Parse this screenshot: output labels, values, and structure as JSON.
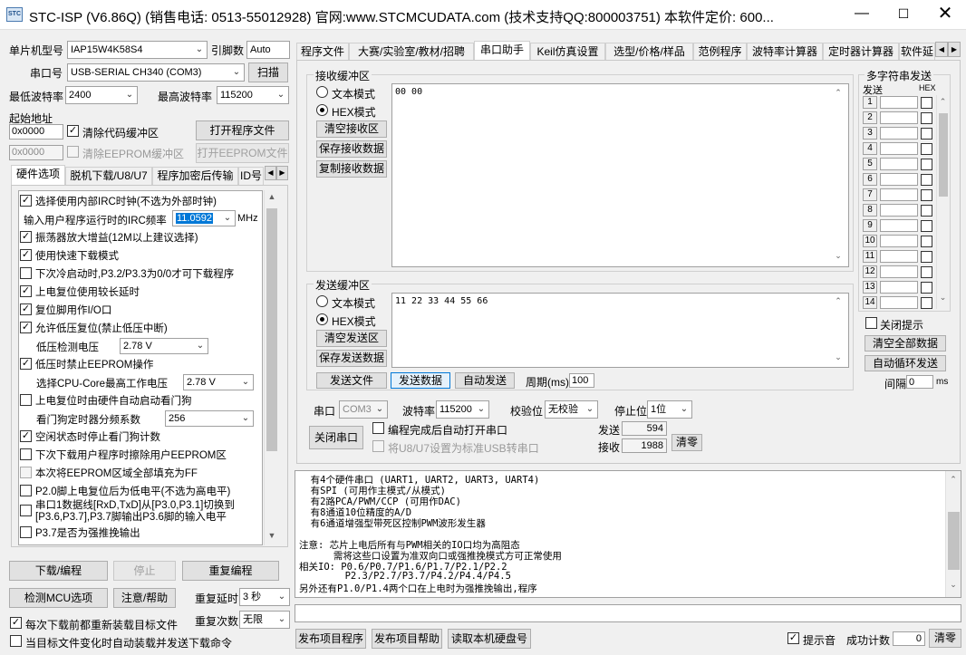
{
  "window": {
    "title": "STC-ISP (V6.86Q) (销售电话: 0513-55012928) 官网:www.STCMCUDATA.com  (技术支持QQ:800003751) 本软件定价: 600...",
    "icon_text": "STC"
  },
  "left": {
    "mcu_label": "单片机型号",
    "mcu_value": "IAP15W4K58S4",
    "pin_label": "引脚数",
    "pin_value": "Auto",
    "port_label": "串口号",
    "port_value": "USB-SERIAL CH340 (COM3)",
    "scan_btn": "扫描",
    "minbaud_label": "最低波特率",
    "minbaud_value": "2400",
    "maxbaud_label": "最高波特率",
    "maxbaud_value": "115200",
    "start_addr_label": "起始地址",
    "addr1": "0x0000",
    "clear_code_label": "清除代码缓冲区",
    "open_prog_btn": "打开程序文件",
    "addr2": "0x0000",
    "clear_eeprom_label": "清除EEPROM缓冲区",
    "open_eeprom_btn": "打开EEPROM文件",
    "tabs": [
      "硬件选项",
      "脱机下载/U8/U7",
      "程序加密后传输",
      "ID号"
    ],
    "options": {
      "irc_label": "选择使用内部IRC时钟(不选为外部时钟)",
      "freq_label": "输入用户程序运行时的IRC频率",
      "freq_value": "11.0592",
      "freq_unit": "MHz",
      "osc_gain": "振荡器放大增益(12M以上建议选择)",
      "fast_dl": "使用快速下载模式",
      "cold_boot": "下次冷启动时,P3.2/P3.3为0/0才可下载程序",
      "reset_delay": "上电复位使用较长延时",
      "reset_pin": "复位脚用作I/O口",
      "low_volt_reset": "允许低压复位(禁止低压中断)",
      "low_volt_label": "低压检测电压",
      "low_volt_value": "2.78 V",
      "low_volt_eeprom": "低压时禁止EEPROM操作",
      "cpu_volt_label": "选择CPU-Core最高工作电压",
      "cpu_volt_value": "2.78 V",
      "wdt_poweron": "上电复位时由硬件自动启动看门狗",
      "wdt_div_label": "看门狗定时器分频系数",
      "wdt_div_value": "256",
      "idle_wdt": "空闲状态时停止看门狗计数",
      "erase_eeprom": "下次下载用户程序时擦除用户EEPROM区",
      "fill_ff": "本次将EEPROM区域全部填充为FF",
      "p20_low": "P2.0脚上电复位后为低电平(不选为高电平)",
      "uart_switch_1": "串口1数据线[RxD,TxD]从[P3.0,P3.1]切换到",
      "uart_switch_2": "[P3.6,P3.7],P3.7脚输出P3.6脚的输入电平",
      "p37_pushpull": "P3.7是否为强推挽输出"
    },
    "download_btn": "下载/编程",
    "stop_btn": "停止",
    "reprogram_btn": "重复编程",
    "detect_btn": "检测MCU选项",
    "help_btn": "注意/帮助",
    "repeat_delay_label": "重复延时",
    "repeat_delay_value": "3 秒",
    "reload_label": "每次下载前都重新装载目标文件",
    "repeat_count_label": "重复次数",
    "repeat_count_value": "无限",
    "auto_send_label": "当目标文件变化时自动装载并发送下载命令"
  },
  "right": {
    "tabs": [
      "程序文件",
      "大赛/实验室/教材/招聘",
      "串口助手",
      "Keil仿真设置",
      "选型/价格/样品",
      "范例程序",
      "波特率计算器",
      "定时器计算器",
      "软件延"
    ],
    "recv": {
      "group": "接收缓冲区",
      "text_mode": "文本模式",
      "hex_mode": "HEX模式",
      "clear_btn": "清空接收区",
      "save_btn": "保存接收数据",
      "copy_btn": "复制接收数据",
      "content": "00 00"
    },
    "send": {
      "group": "发送缓冲区",
      "text_mode": "文本模式",
      "hex_mode": "HEX模式",
      "clear_btn": "清空发送区",
      "save_btn": "保存发送数据",
      "content": "11 22 33 44 55 66",
      "send_file_btn": "发送文件",
      "send_data_btn": "发送数据",
      "auto_send_btn": "自动发送",
      "period_label": "周期(ms)",
      "period_value": "100"
    },
    "multi": {
      "title": "多字符串发送",
      "send_col": "发送",
      "hex_col": "HEX",
      "rows": [
        "1",
        "2",
        "3",
        "4",
        "5",
        "6",
        "7",
        "8",
        "9",
        "10",
        "11",
        "12",
        "13",
        "14"
      ],
      "close_tip": "关闭提示",
      "clear_all_btn": "清空全部数据",
      "auto_loop_btn": "自动循环发送",
      "interval_label": "间隔",
      "interval_value": "0",
      "interval_unit": "ms"
    },
    "port_label": "串口",
    "port_value": "COM3",
    "baud_label": "波特率",
    "baud_value": "115200",
    "parity_label": "校验位",
    "parity_value": "无校验",
    "stop_label": "停止位",
    "stop_value": "1位",
    "close_port_btn": "关闭串口",
    "auto_open_label": "编程完成后自动打开串口",
    "u8_label": "将U8/U7设置为标准USB转串口",
    "sent_label": "发送",
    "sent_value": "594",
    "recv_label": "接收",
    "recv_value": "1988",
    "zero_btn": "清零"
  },
  "log": [
    "  有4个硬件串口 (UART1, UART2, UART3, UART4)",
    "  有SPI (可用作主模式/从模式)",
    "  有2路PCA/PWM/CCP (可用作DAC)",
    "  有8通道10位精度的A/D",
    "  有6通道增强型带死区控制PWM波形发生器",
    "",
    "注意: 芯片上电后所有与PWM相关的IO口均为高阻态",
    "      需将这些口设置为准双向口或强推挽模式方可正常使用",
    "相关IO: P0.6/P0.7/P1.6/P1.7/P2.1/P2.2",
    "        P2.3/P2.7/P3.7/P4.2/P4.4/P4.5",
    "另外还有P1.0/P1.4两个口在上电时为强推挽输出,程序"
  ],
  "bottom": {
    "publish_prog_btn": "发布项目程序",
    "publish_help_btn": "发布项目帮助",
    "read_disk_btn": "读取本机硬盘号",
    "tone_label": "提示音",
    "success_label": "成功计数",
    "success_value": "0",
    "clear_btn": "清零"
  }
}
